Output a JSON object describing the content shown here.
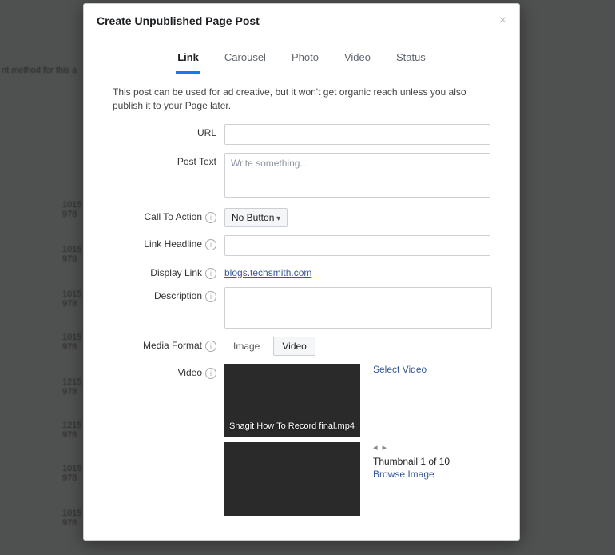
{
  "background": {
    "hint": "nt method for this a",
    "rows": [
      {
        "c1": "1015",
        "c2": "978"
      },
      {
        "c1": "1015",
        "c2": "978"
      },
      {
        "c1": "1015",
        "c2": "978"
      },
      {
        "c1": "1015",
        "c2": "978"
      },
      {
        "c1": "1215",
        "c2": "978"
      },
      {
        "c1": "1215",
        "c2": "978"
      },
      {
        "c1": "1015",
        "c2": "978"
      },
      {
        "c1": "1015",
        "c2": "978"
      }
    ],
    "leftLabels": [
      "",
      "",
      "",
      "",
      "",
      "",
      "",
      ""
    ]
  },
  "modal": {
    "title": "Create Unpublished Page Post",
    "tabs": [
      "Link",
      "Carousel",
      "Photo",
      "Video",
      "Status"
    ],
    "activeTab": 0,
    "note": "This post can be used for ad creative, but it won't get organic reach unless you also publish it to your Page later.",
    "labels": {
      "url": "URL",
      "postText": "Post Text",
      "cta": "Call To Action",
      "headline": "Link Headline",
      "displayLink": "Display Link",
      "description": "Description",
      "mediaFormat": "Media Format",
      "video": "Video"
    },
    "fields": {
      "postTextPlaceholder": "Write something...",
      "ctaValue": "No Button",
      "displayLinkValue": "blogs.techsmith.com"
    },
    "mediaTabs": [
      "Image",
      "Video"
    ],
    "mediaActive": 1,
    "videoArea": {
      "thumbTitle": "Snagit How To Record final.mp4",
      "selectVideo": "Select Video",
      "thumbCounter": "Thumbnail 1 of 10",
      "browseImage": "Browse Image"
    }
  }
}
